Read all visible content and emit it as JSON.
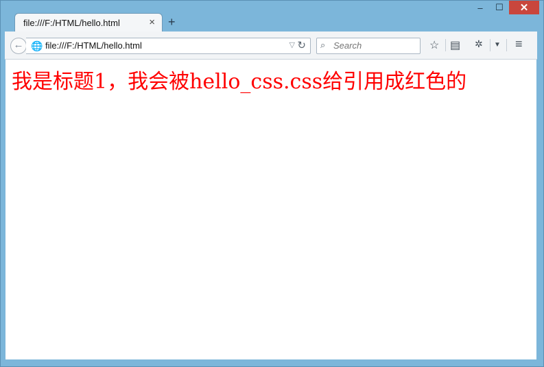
{
  "window": {
    "controls": {
      "minimize": "–",
      "maximize": "☐",
      "close": "✕"
    }
  },
  "tab": {
    "title": "file:///F:/HTML/hello.html",
    "close": "×",
    "new_tab": "+"
  },
  "toolbar": {
    "back": "←",
    "address": "file:///F:/HTML/hello.html",
    "search_placeholder": "Search"
  },
  "page": {
    "heading": "我是标题1，我会被hello_css.css给引用成红色的",
    "heading_color": "#ff0000"
  }
}
